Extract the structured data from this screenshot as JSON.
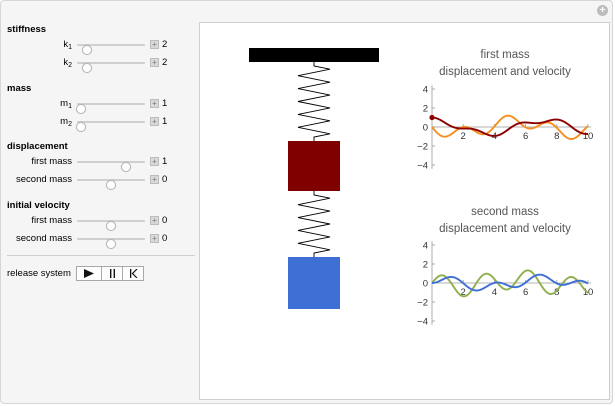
{
  "controls": {
    "stiffness": {
      "title": "stiffness",
      "k1": {
        "label": "k",
        "sub": "1",
        "value": "2",
        "fraction": 0.14
      },
      "k2": {
        "label": "k",
        "sub": "2",
        "value": "2",
        "fraction": 0.14
      }
    },
    "mass": {
      "title": "mass",
      "m1": {
        "label": "m",
        "sub": "1",
        "value": "1",
        "fraction": 0.06
      },
      "m2": {
        "label": "m",
        "sub": "2",
        "value": "1",
        "fraction": 0.06
      }
    },
    "displacement": {
      "title": "displacement",
      "first": {
        "label": "first mass",
        "value": "1",
        "fraction": 0.72
      },
      "second": {
        "label": "second mass",
        "value": "0",
        "fraction": 0.5
      }
    },
    "initial_velocity": {
      "title": "initial velocity",
      "first": {
        "label": "first mass",
        "value": "0",
        "fraction": 0.5
      },
      "second": {
        "label": "second mass",
        "value": "0",
        "fraction": 0.5
      }
    }
  },
  "release": {
    "label": "release system",
    "buttons": [
      "play-icon",
      "pause-icon",
      "step-back-icon"
    ]
  },
  "colors": {
    "mass1": "#800000",
    "mass2": "#3e6fd5",
    "support": "#000000",
    "disp1": "#8b0000",
    "vel1": "#f5901e",
    "disp2": "#3e6fd5",
    "vel2": "#8fb04c"
  },
  "plot1": {
    "title_line1": "first mass",
    "title_line2": "displacement and velocity",
    "yticks": [
      "4",
      "2",
      "0",
      "−2",
      "−4"
    ],
    "xticks": [
      "2",
      "4",
      "6",
      "8",
      "10"
    ]
  },
  "plot2": {
    "title_line1": "second mass",
    "title_line2": "displacement and velocity",
    "yticks": [
      "4",
      "2",
      "0",
      "−2",
      "−4"
    ],
    "xticks": [
      "2",
      "4",
      "6",
      "8",
      "10"
    ]
  }
}
